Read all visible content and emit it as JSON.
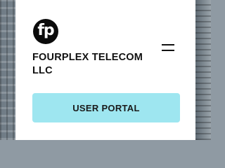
{
  "brand": {
    "logo_text": "fp",
    "name": "FOURPLEX TELECOM LLC"
  },
  "nav": {
    "menu_icon": "hamburger-menu-icon"
  },
  "actions": {
    "user_portal_label": "USER PORTAL"
  },
  "colors": {
    "panel_background": "#ffffff",
    "button_background": "#9ee6f0",
    "logo_background": "#0b0b0b",
    "text": "#111111"
  }
}
